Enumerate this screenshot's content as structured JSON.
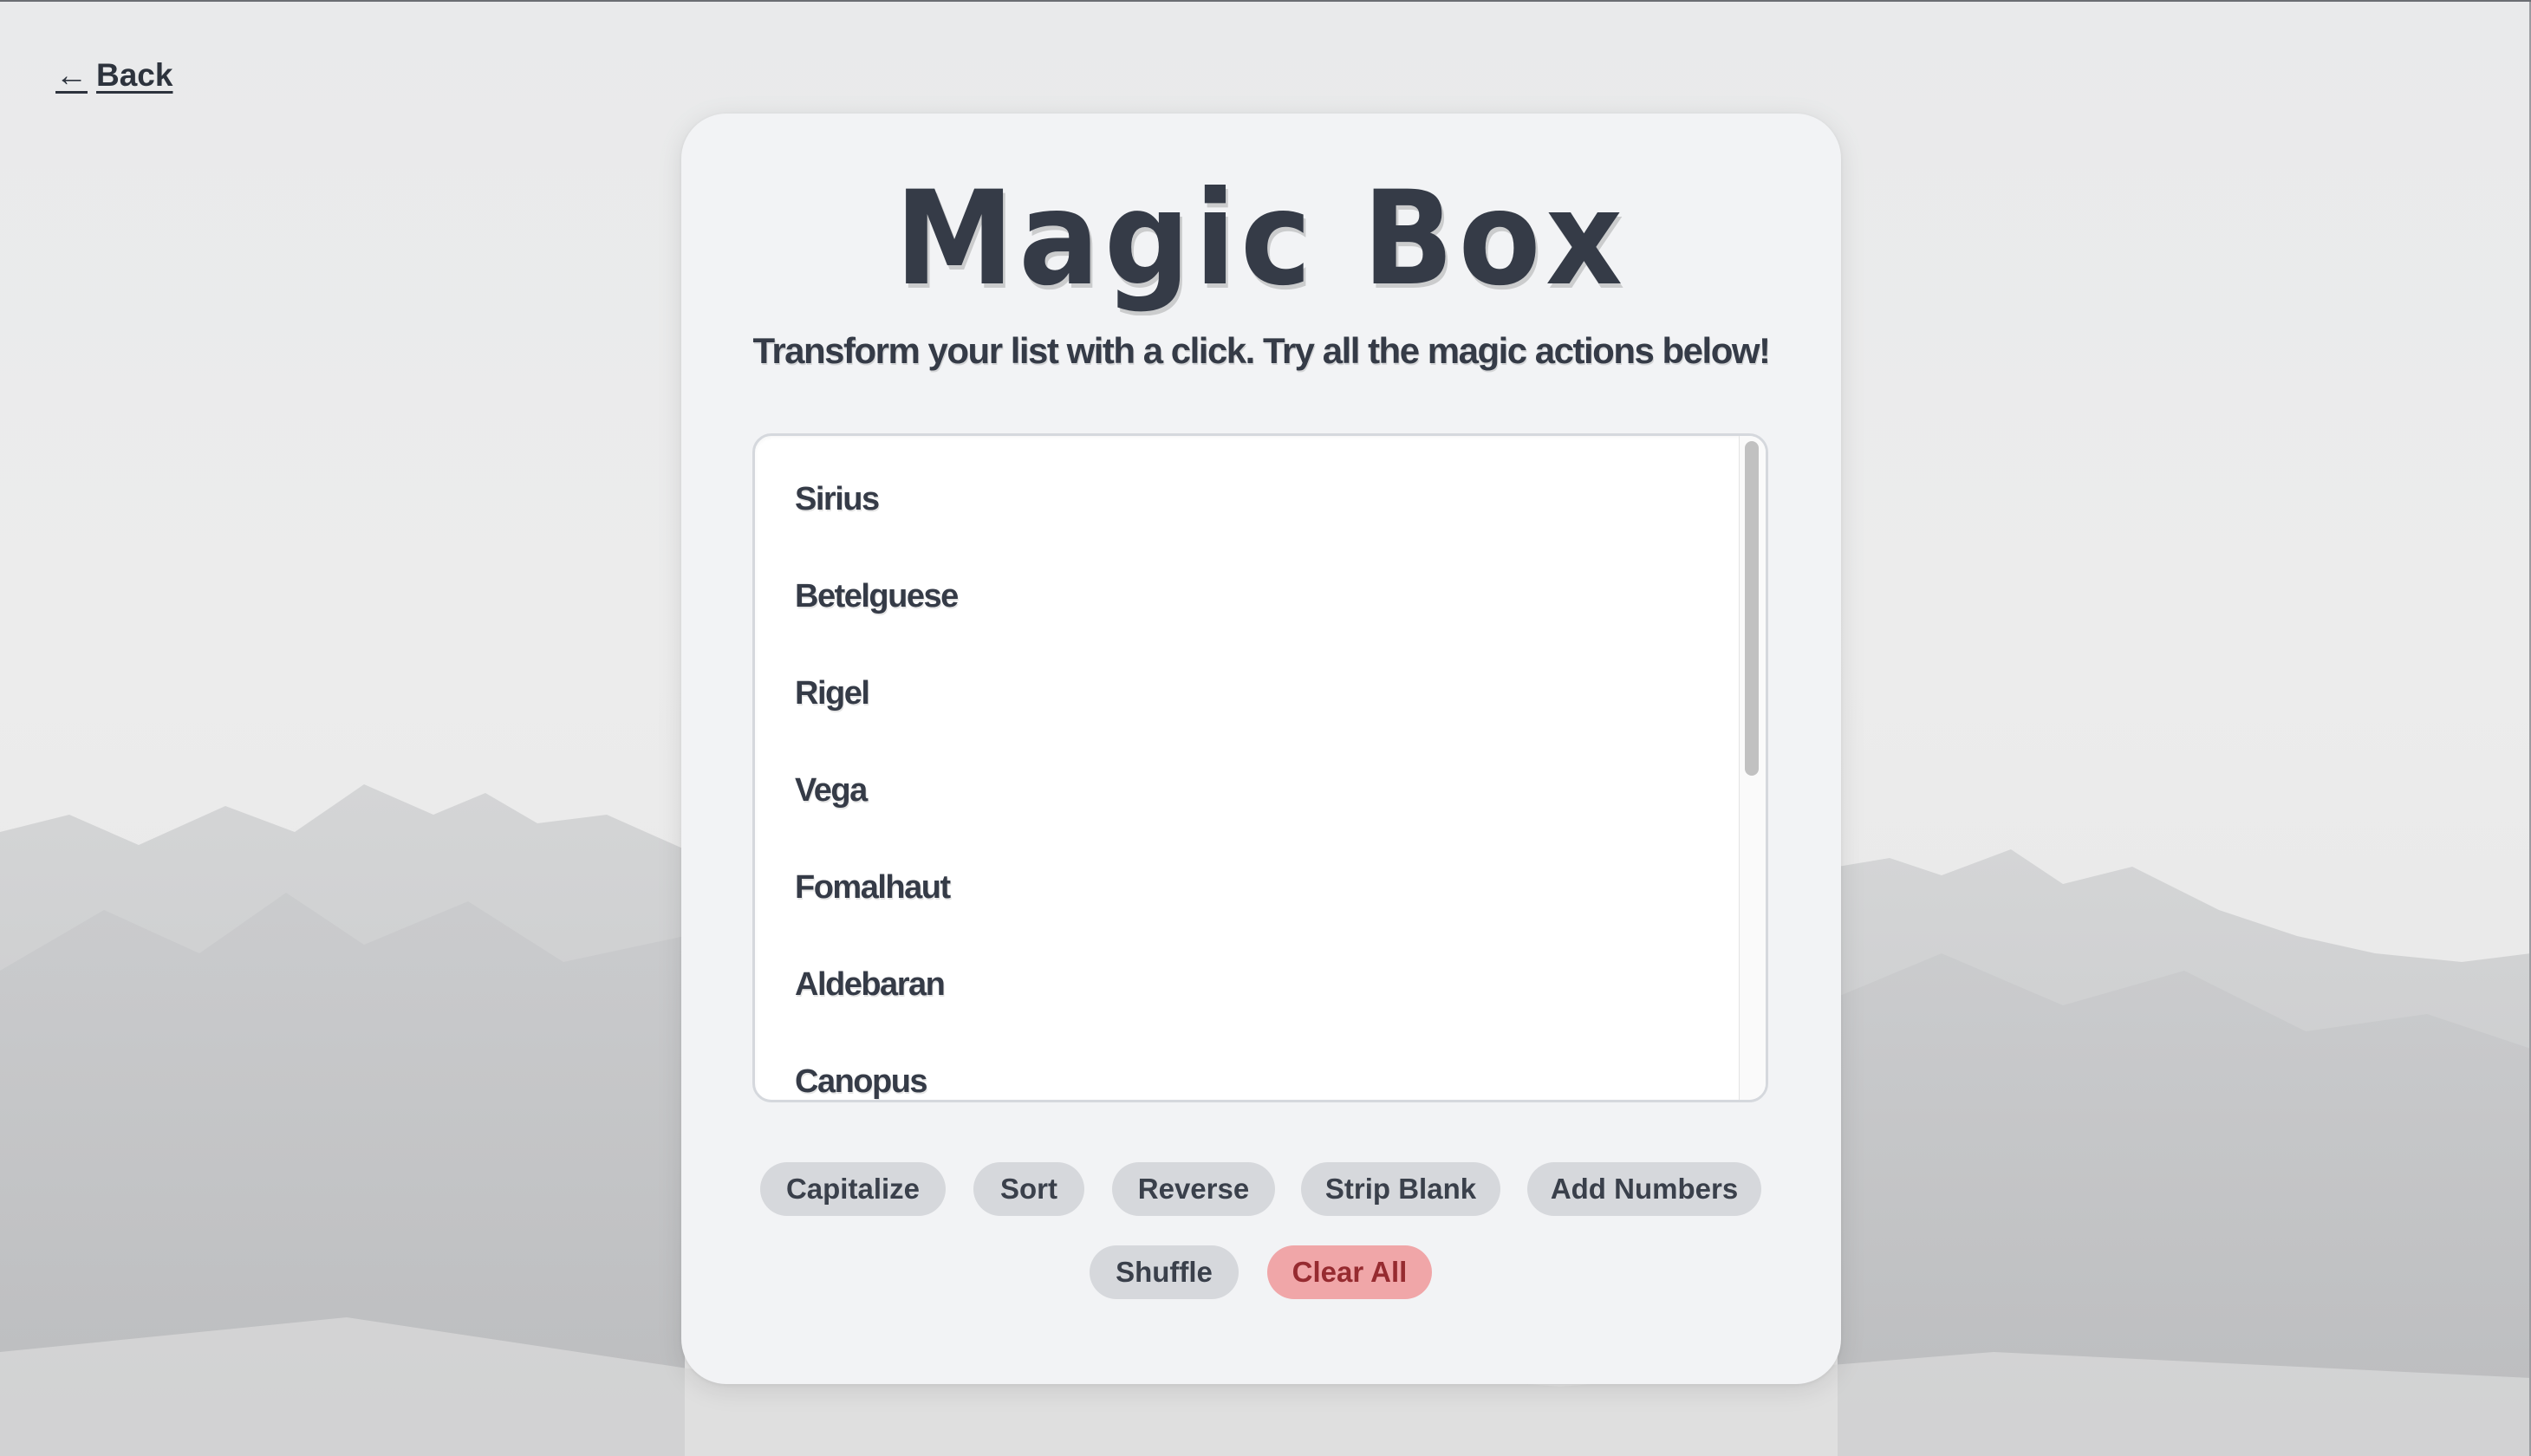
{
  "nav": {
    "back_arrow": "←",
    "back_label": "Back"
  },
  "header": {
    "title": "Magic Box",
    "subtitle": "Transform your list with a click. Try all the magic actions below!"
  },
  "list": {
    "items": [
      "Sirius",
      "Betelguese",
      "Rigel",
      "Vega",
      "Fomalhaut",
      "Aldebaran",
      "Canopus"
    ]
  },
  "actions": {
    "capitalize": "Capitalize",
    "sort": "Sort",
    "reverse": "Reverse",
    "strip_blank": "Strip Blank",
    "add_numbers": "Add Numbers",
    "shuffle": "Shuffle",
    "clear_all": "Clear All"
  },
  "colors": {
    "text_dark": "#353b47",
    "button_bg": "#d6d8dc",
    "danger_bg": "#f0a6a8",
    "danger_text": "#962b30",
    "card_bg": "#f2f3f5"
  }
}
